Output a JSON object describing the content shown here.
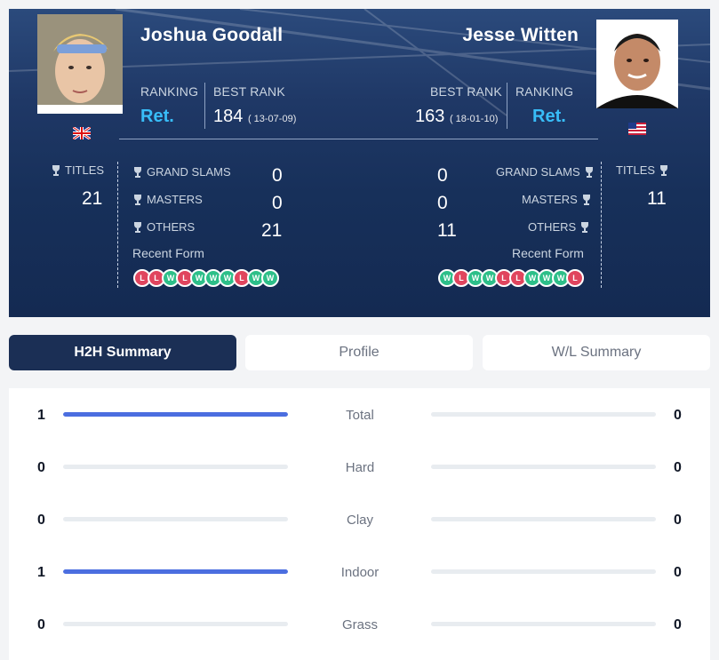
{
  "players": {
    "left": {
      "name": "Joshua Goodall",
      "flag": "GB",
      "ranking_label": "RANKING",
      "ranking": "Ret.",
      "best_rank_label": "BEST RANK",
      "best_rank": "184",
      "best_rank_date": "( 13-07-09)",
      "titles_label": "TITLES",
      "titles": "21",
      "grand_slams_label": "GRAND SLAMS",
      "grand_slams": "0",
      "masters_label": "MASTERS",
      "masters": "0",
      "others_label": "OTHERS",
      "others": "21",
      "recent_form_label": "Recent Form",
      "recent_form": [
        "L",
        "L",
        "W",
        "L",
        "W",
        "W",
        "W",
        "L",
        "W",
        "W"
      ]
    },
    "right": {
      "name": "Jesse Witten",
      "flag": "US",
      "ranking_label": "RANKING",
      "ranking": "Ret.",
      "best_rank_label": "BEST RANK",
      "best_rank": "163",
      "best_rank_date": "( 18-01-10)",
      "titles_label": "TITLES",
      "titles": "11",
      "grand_slams_label": "GRAND SLAMS",
      "grand_slams": "0",
      "masters_label": "MASTERS",
      "masters": "0",
      "others_label": "OTHERS",
      "others": "11",
      "recent_form_label": "Recent Form",
      "recent_form": [
        "W",
        "L",
        "W",
        "W",
        "L",
        "L",
        "W",
        "W",
        "W",
        "L"
      ]
    }
  },
  "tabs": [
    {
      "label": "H2H Summary",
      "active": true
    },
    {
      "label": "Profile",
      "active": false
    },
    {
      "label": "W/L Summary",
      "active": false
    }
  ],
  "h2h": [
    {
      "surface": "Total",
      "left": 1,
      "right": 0
    },
    {
      "surface": "Hard",
      "left": 0,
      "right": 0
    },
    {
      "surface": "Clay",
      "left": 0,
      "right": 0
    },
    {
      "surface": "Indoor",
      "left": 1,
      "right": 0
    },
    {
      "surface": "Grass",
      "left": 0,
      "right": 0
    }
  ],
  "colors": {
    "accent": "#38bdf8",
    "win": "#2dbf89",
    "loss": "#e0455e",
    "bar_fill": "#4b6ee0",
    "active_tab": "#1b2f55"
  }
}
